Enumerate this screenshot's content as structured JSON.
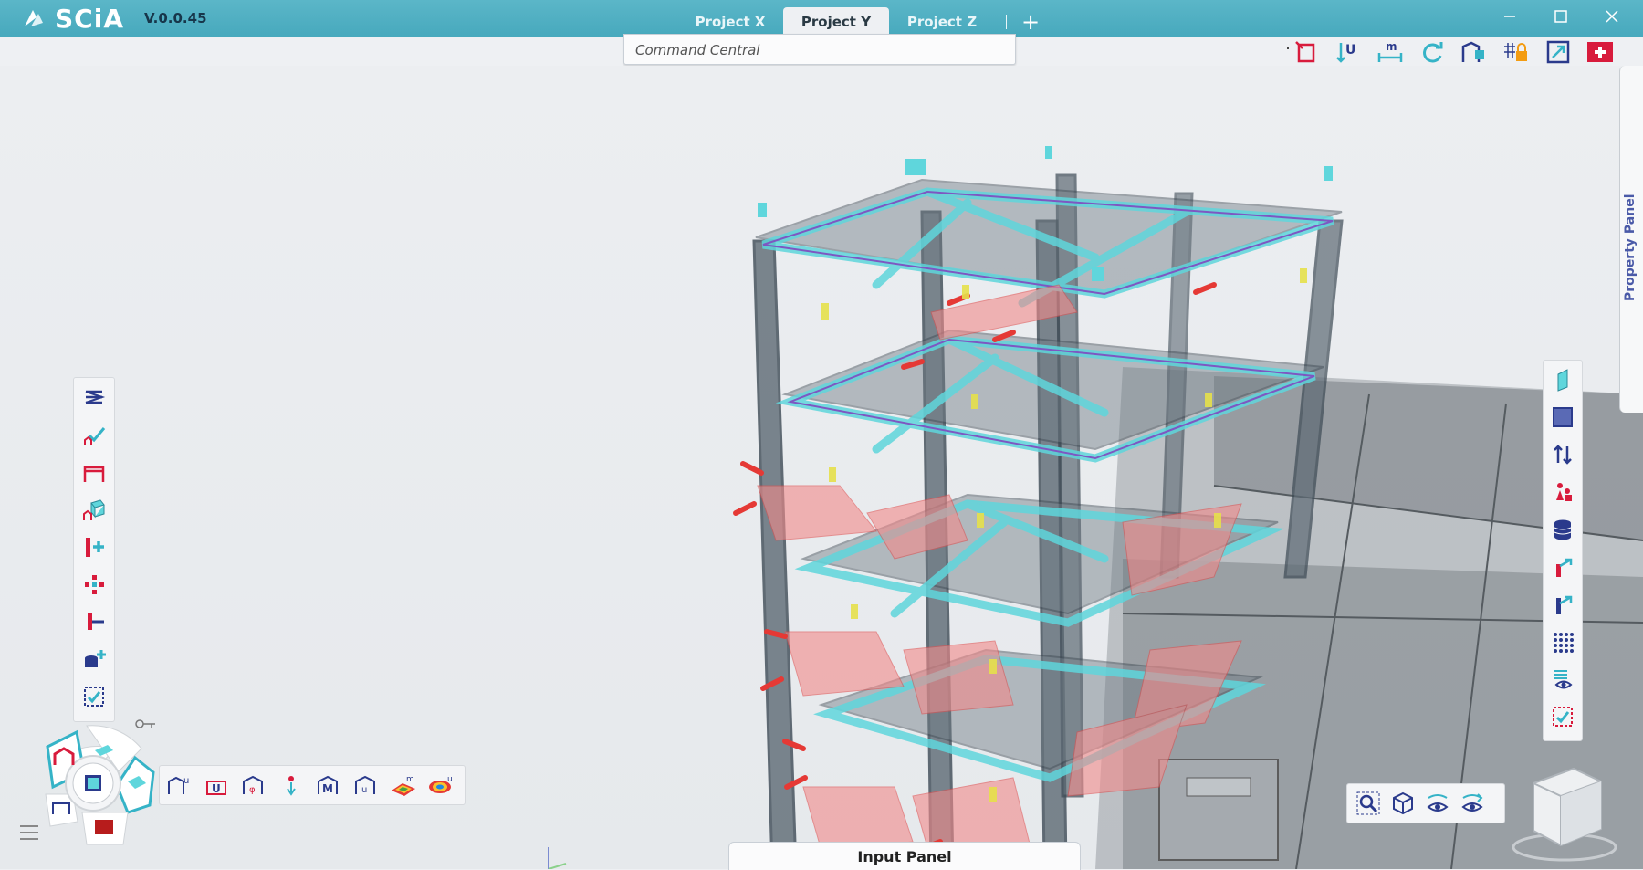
{
  "app": {
    "logo": "SCiA",
    "version": "V.0.0.45"
  },
  "tabs": [
    {
      "label": "Project X",
      "active": false
    },
    {
      "label": "Project Y",
      "active": true
    },
    {
      "label": "Project Z",
      "active": false
    }
  ],
  "tab_add": "+",
  "window_controls": [
    "minimize-icon",
    "maximize-icon",
    "close-icon"
  ],
  "command": {
    "placeholder": "Command Central"
  },
  "top_toolbar": [
    "shape-select-icon",
    "u-arrows-icon",
    "m-measure-icon",
    "refresh-icon",
    "frame-settings-icon",
    "lock-grid-icon",
    "resize-view-icon",
    "swiss-flag-icon"
  ],
  "left_toolbar": [
    "layers-icon",
    "check-model-icon",
    "frame-icon",
    "structure-3d-icon",
    "member-add-icon",
    "nodes-icon",
    "support-icon",
    "database-add-icon",
    "select-check-icon"
  ],
  "bottom_toolbar": [
    "frame-u-icon",
    "u-deform-icon",
    "phi-frame-icon",
    "person-icon",
    "m-frame-icon",
    "u-portal-icon",
    "contour-m-icon",
    "contour-u-icon"
  ],
  "right_toolbar": [
    "panel-icon",
    "square-icon",
    "double-arrow-icon",
    "persons-icon",
    "database-icon",
    "member-red-icon",
    "member-blue-icon",
    "dot-grid-icon",
    "eye-list-icon",
    "select-check-icon"
  ],
  "view_toolbar": [
    "zoom-icon",
    "cube-view-icon",
    "eye-rotate-icon",
    "eye-orbit-icon"
  ],
  "property_panel": {
    "label": "Property Panel"
  },
  "input_panel": {
    "label": "Input Panel"
  },
  "colors": {
    "titlebar": "#4fb0c3",
    "accent": "#d81b3c",
    "teal": "#35b3c7",
    "navy": "#2a3a8c"
  }
}
